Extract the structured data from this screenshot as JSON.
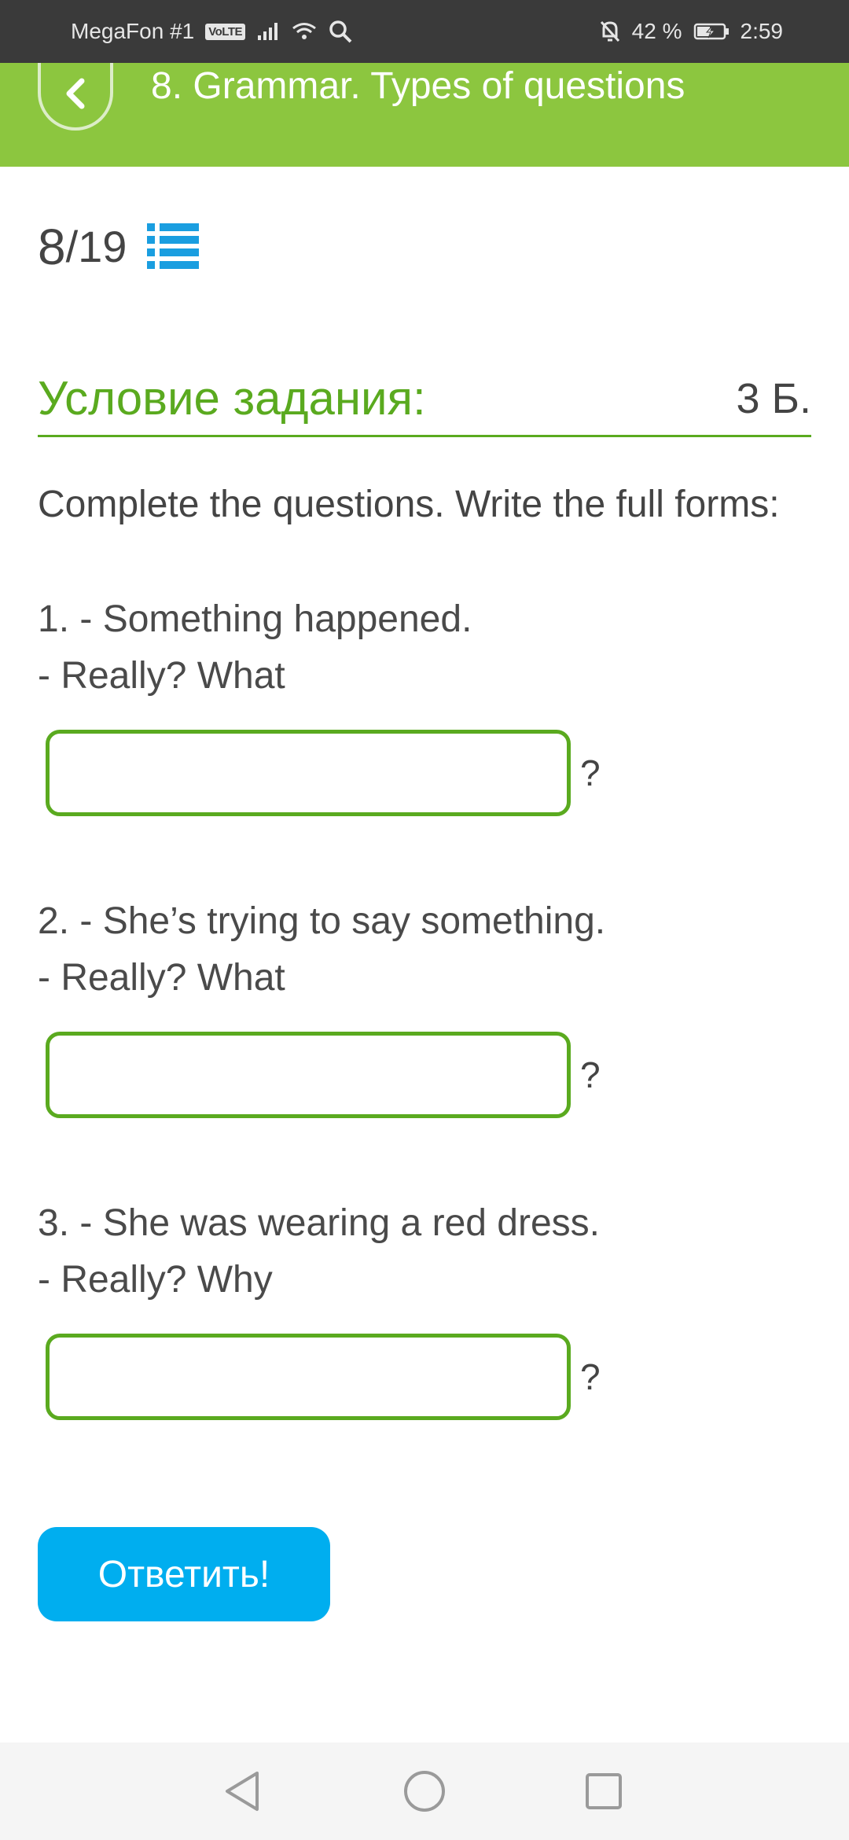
{
  "status_bar": {
    "carrier": "MegaFon #1",
    "volte": "VoLTE",
    "battery": "42 %",
    "time": "2:59"
  },
  "header": {
    "title": "8. Grammar. Types of questions"
  },
  "progress": {
    "current": "8",
    "total": "/19"
  },
  "task": {
    "condition_label": "Условие задания:",
    "points": "3 Б.",
    "instruction": "Complete the questions. Write the full forms:"
  },
  "questions": [
    {
      "line1": "1. - Something happened.",
      "line2": "- Really? What",
      "answer": "",
      "suffix": "?"
    },
    {
      "line1": "2. - She’s trying to say something.",
      "line2": "- Really? What",
      "answer": "",
      "suffix": "?"
    },
    {
      "line1": "3. - She was wearing a red dress.",
      "line2": "- Really? Why",
      "answer": "",
      "suffix": "?"
    }
  ],
  "submit": {
    "label": "Ответить!"
  },
  "colors": {
    "header_green": "#8cc63f",
    "accent_green": "#5aaa1f",
    "button_blue": "#00aeef",
    "status_bar": "#3a3a3a"
  }
}
